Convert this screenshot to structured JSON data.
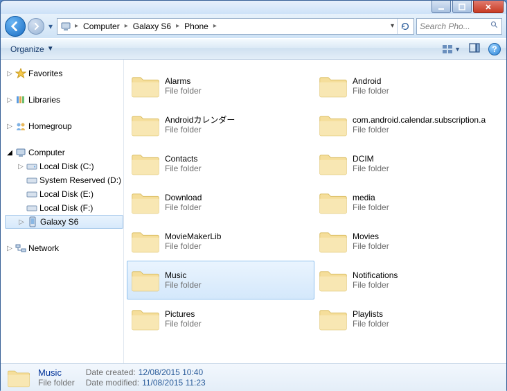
{
  "breadcrumbs": [
    "Computer",
    "Galaxy S6",
    "Phone"
  ],
  "search_placeholder": "Search Pho...",
  "toolbar": {
    "organize_label": "Organize"
  },
  "nav": {
    "favorites": "Favorites",
    "libraries": "Libraries",
    "homegroup": "Homegroup",
    "computer": "Computer",
    "computer_children": [
      "Local Disk (C:)",
      "System Reserved (D:)",
      "Local Disk (E:)",
      "Local Disk (F:)",
      "Galaxy S6"
    ],
    "network": "Network"
  },
  "folders_left": [
    {
      "name": "Alarms",
      "type": "File folder"
    },
    {
      "name": "Androidカレンダー",
      "type": "File folder"
    },
    {
      "name": "Contacts",
      "type": "File folder"
    },
    {
      "name": "Download",
      "type": "File folder"
    },
    {
      "name": "MovieMakerLib",
      "type": "File folder"
    },
    {
      "name": "Music",
      "type": "File folder",
      "selected": true
    },
    {
      "name": "Pictures",
      "type": "File folder"
    }
  ],
  "folders_right": [
    {
      "name": "Android",
      "type": "File folder"
    },
    {
      "name": "com.android.calendar.subscription.a",
      "type": "File folder"
    },
    {
      "name": "DCIM",
      "type": "File folder"
    },
    {
      "name": "media",
      "type": "File folder"
    },
    {
      "name": "Movies",
      "type": "File folder"
    },
    {
      "name": "Notifications",
      "type": "File folder"
    },
    {
      "name": "Playlists",
      "type": "File folder"
    }
  ],
  "details": {
    "name": "Music",
    "type": "File folder",
    "created_label": "Date created:",
    "created_value": "12/08/2015 10:40",
    "modified_label": "Date modified:",
    "modified_value": "11/08/2015 11:23"
  }
}
